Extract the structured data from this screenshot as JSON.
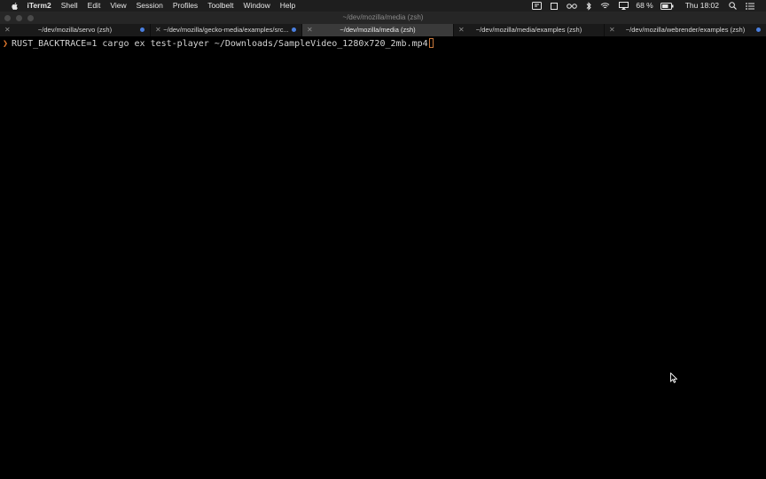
{
  "menubar": {
    "app_name": "iTerm2",
    "menus": [
      "Shell",
      "Edit",
      "View",
      "Session",
      "Profiles",
      "Toolbelt",
      "Window",
      "Help"
    ],
    "battery_percent": "68 %",
    "clock": "Thu 18:02",
    "status_icons": [
      "keyboard-icon",
      "square-icon",
      "glasses-icon",
      "bluetooth-icon",
      "wifi-icon",
      "airplay-icon",
      "battery-icon",
      "spotlight-icon",
      "notification-center-icon"
    ]
  },
  "window": {
    "title": "~/dev/mozilla/media (zsh)"
  },
  "tabs": [
    {
      "label": "~/dev/mozilla/servo (zsh)",
      "active": false,
      "activity": true
    },
    {
      "label": "~/dev/mozilla/gecko-media/examples/src...",
      "active": false,
      "activity": true
    },
    {
      "label": "~/dev/mozilla/media (zsh)",
      "active": true,
      "activity": false
    },
    {
      "label": "~/dev/mozilla/media/examples (zsh)",
      "active": false,
      "activity": false
    },
    {
      "label": "~/dev/mozilla/webrender/examples (zsh)",
      "active": false,
      "activity": true
    }
  ],
  "terminal": {
    "prompt_symbol": "❯",
    "command": "RUST_BACKTRACE=1 cargo ex test-player ~/Downloads/SampleVideo_1280x720_2mb.mp4"
  },
  "colors": {
    "prompt": "#e0772d",
    "tab_activity": "#4a7fe0",
    "background": "#000000"
  }
}
